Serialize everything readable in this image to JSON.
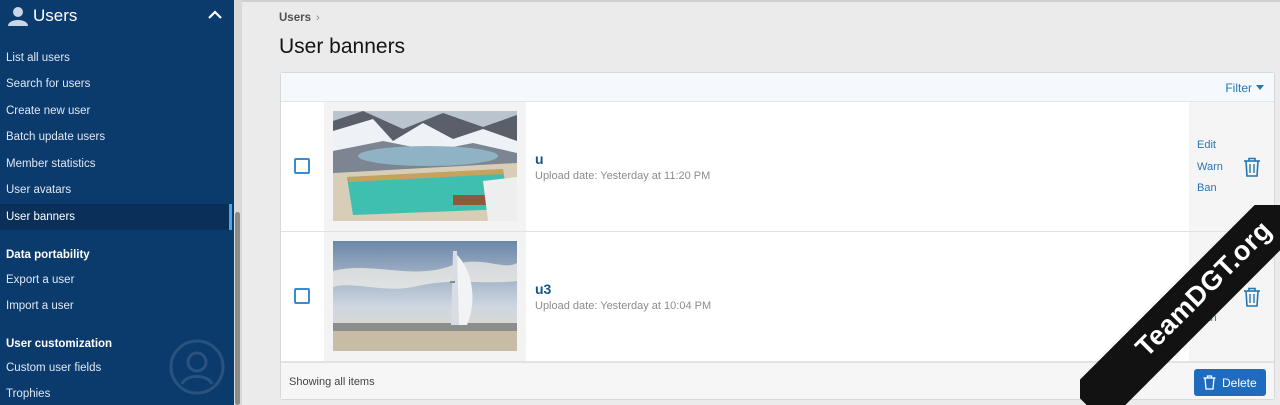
{
  "sidebar": {
    "title": "Users",
    "items": [
      {
        "label": "List all users"
      },
      {
        "label": "Search for users"
      },
      {
        "label": "Create new user"
      },
      {
        "label": "Batch update users"
      },
      {
        "label": "Member statistics"
      },
      {
        "label": "User avatars"
      },
      {
        "label": "User banners",
        "active": true
      }
    ],
    "sections": [
      {
        "title": "Data portability",
        "items": [
          {
            "label": "Export a user"
          },
          {
            "label": "Import a user"
          }
        ]
      },
      {
        "title": "User customization",
        "items": [
          {
            "label": "Custom user fields"
          },
          {
            "label": "Trophies"
          }
        ]
      }
    ]
  },
  "breadcrumb": {
    "label": "Users",
    "separator": "›"
  },
  "page": {
    "title": "User banners"
  },
  "filter": {
    "label": "Filter"
  },
  "rows": [
    {
      "name": "u",
      "upload": "Upload date: Yesterday at 11:20 PM",
      "image": "mountain-pool-photo"
    },
    {
      "name": "u3",
      "upload": "Upload date: Yesterday at 10:04 PM",
      "image": "burj-al-arab-photo"
    }
  ],
  "actions": {
    "edit": "Edit",
    "warn": "Warn",
    "ban": "Ban"
  },
  "footer": {
    "showing": "Showing all items",
    "delete_label": "Delete"
  },
  "watermark": {
    "text": "TeamDGT.org"
  },
  "colors": {
    "sidebar": "#0b3a6d",
    "accent": "#2577b1",
    "delete": "#1f6cbf"
  }
}
